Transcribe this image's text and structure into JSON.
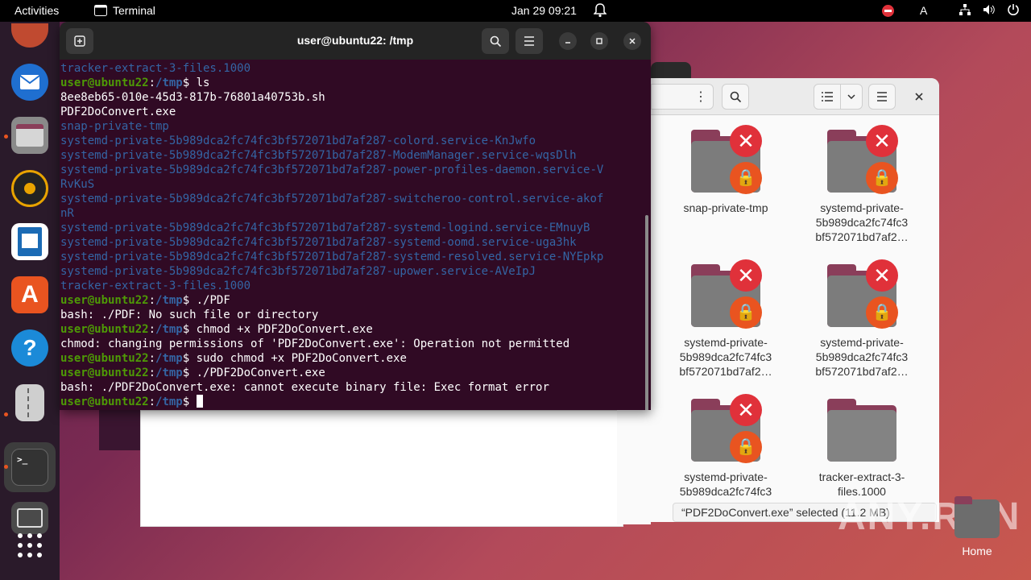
{
  "topbar": {
    "activities": "Activities",
    "app_name": "Terminal",
    "clock": "Jan 29  09:21",
    "keyboard": "A"
  },
  "dock": {
    "items": [
      "Ubuntu",
      "Thunderbird",
      "Files",
      "Rhythmbox",
      "LibreOffice Writer",
      "Ubuntu Software",
      "Help",
      "Archive Manager",
      "Terminal",
      "Trash",
      "Show Apps"
    ]
  },
  "terminal": {
    "title": "user@ubuntu22: /tmp",
    "lines": [
      {
        "type": "blue",
        "text": "tracker-extract-3-files.1000"
      },
      {
        "type": "prompt",
        "user": "user@ubuntu22",
        "path": "/tmp",
        "cmd": " ls"
      },
      {
        "type": "plain",
        "text": "8ee8eb65-010e-45d3-817b-76801a40753b.sh"
      },
      {
        "type": "plain",
        "text": "PDF2DoConvert.exe"
      },
      {
        "type": "blue",
        "text": "snap-private-tmp"
      },
      {
        "type": "blue",
        "text": "systemd-private-5b989dca2fc74fc3bf572071bd7af287-colord.service-KnJwfo"
      },
      {
        "type": "blue",
        "text": "systemd-private-5b989dca2fc74fc3bf572071bd7af287-ModemManager.service-wqsDlh"
      },
      {
        "type": "blue",
        "text": "systemd-private-5b989dca2fc74fc3bf572071bd7af287-power-profiles-daemon.service-V"
      },
      {
        "type": "blue",
        "text": "RvKuS"
      },
      {
        "type": "blue",
        "text": "systemd-private-5b989dca2fc74fc3bf572071bd7af287-switcheroo-control.service-akof"
      },
      {
        "type": "blue",
        "text": "nR"
      },
      {
        "type": "blue",
        "text": "systemd-private-5b989dca2fc74fc3bf572071bd7af287-systemd-logind.service-EMnuyB"
      },
      {
        "type": "blue",
        "text": "systemd-private-5b989dca2fc74fc3bf572071bd7af287-systemd-oomd.service-uga3hk"
      },
      {
        "type": "blue",
        "text": "systemd-private-5b989dca2fc74fc3bf572071bd7af287-systemd-resolved.service-NYEpkp"
      },
      {
        "type": "blue",
        "text": "systemd-private-5b989dca2fc74fc3bf572071bd7af287-upower.service-AVeIpJ"
      },
      {
        "type": "blue",
        "text": "tracker-extract-3-files.1000"
      },
      {
        "type": "prompt",
        "user": "user@ubuntu22",
        "path": "/tmp",
        "cmd": " ./PDF"
      },
      {
        "type": "plain",
        "text": "bash: ./PDF: No such file or directory"
      },
      {
        "type": "prompt",
        "user": "user@ubuntu22",
        "path": "/tmp",
        "cmd": " chmod +x PDF2DoConvert.exe"
      },
      {
        "type": "plain",
        "text": "chmod: changing permissions of 'PDF2DoConvert.exe': Operation not permitted"
      },
      {
        "type": "prompt",
        "user": "user@ubuntu22",
        "path": "/tmp",
        "cmd": " sudo chmod +x PDF2DoConvert.exe"
      },
      {
        "type": "prompt",
        "user": "user@ubuntu22",
        "path": "/tmp",
        "cmd": " ./PDF2DoConvert.exe"
      },
      {
        "type": "plain",
        "text": "bash: ./PDF2DoConvert.exe: cannot execute binary file: Exec format error"
      },
      {
        "type": "prompt",
        "user": "user@ubuntu22",
        "path": "/tmp",
        "cmd": " ",
        "cursor": true
      }
    ]
  },
  "files": {
    "items": [
      {
        "name": "snap-private-tmp",
        "locked": true
      },
      {
        "name": "systemd-private-5b989dca2fc74fc3 bf572071bd7af2…",
        "locked": true
      },
      {
        "name": "systemd-private-5b989dca2fc74fc3 bf572071bd7af2…",
        "locked": true
      },
      {
        "name": "systemd-private-5b989dca2fc74fc3 bf572071bd7af2…",
        "locked": true
      },
      {
        "name": "systemd-private-5b989dca2fc74fc3",
        "locked": true
      },
      {
        "name": "tracker-extract-3-files.1000",
        "locked": false
      }
    ],
    "status": "“PDF2DoConvert.exe” selected (11.2 MB)"
  },
  "desktop": {
    "home_label": "Home",
    "watermark": "ANY.RUN"
  },
  "colors": {
    "prompt_green": "#4e9a06",
    "dir_blue": "#3465a4",
    "terminal_bg": "#300a24",
    "ubuntu_orange": "#e95420",
    "error_red": "#e0313a"
  }
}
